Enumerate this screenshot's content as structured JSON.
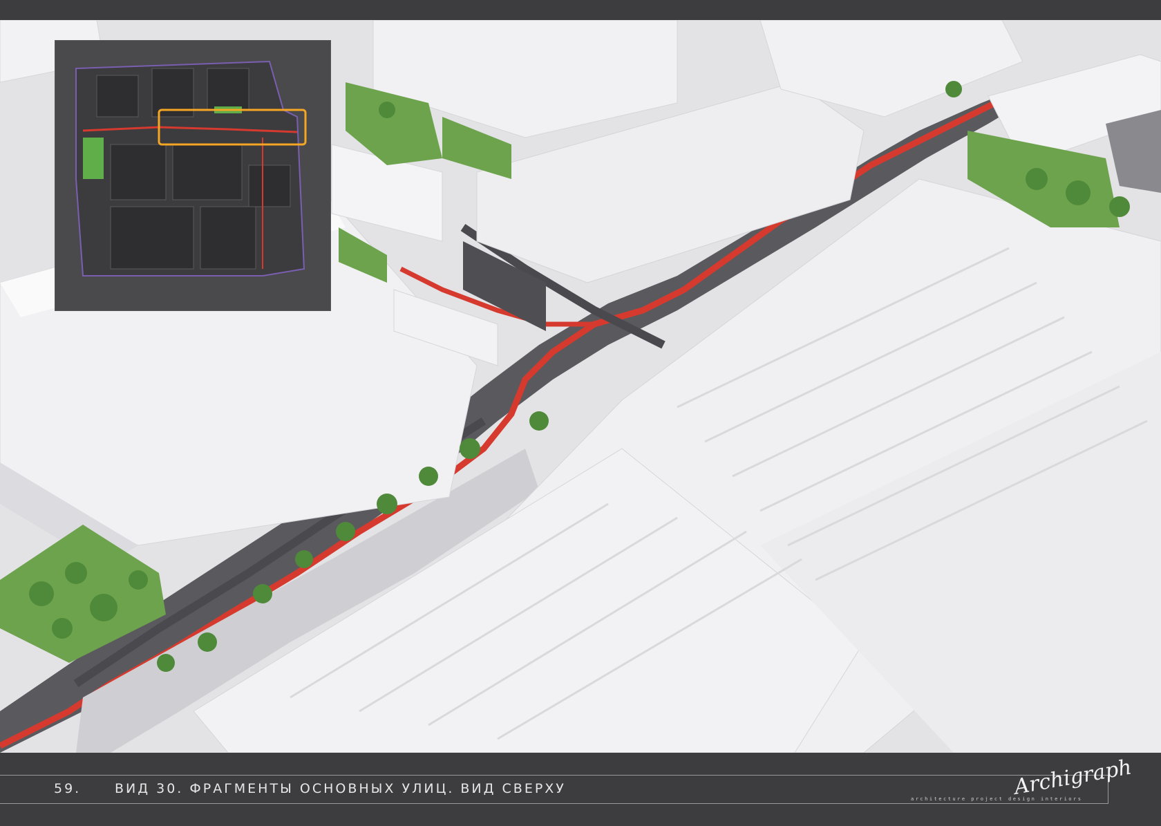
{
  "footer": {
    "page_number": "59.",
    "caption": "ВИД 30. ФРАГМЕНТЫ ОСНОВНЫХ УЛИЦ. ВИД СВЕРХУ"
  },
  "logo": {
    "signature": "Archigraph",
    "tagline": "architecture project design interiors"
  },
  "colors": {
    "route_red": "#d63a2e",
    "inset_highlight": "#f5a623",
    "greenery": "#6da34d",
    "buildings": "#efeff2",
    "background": "#3d3d3f"
  },
  "render": {
    "subject": "aerial view of industrial district streets with red pedestrian route and green plazas",
    "inset_plan": "site plan with highlighted fragment"
  }
}
